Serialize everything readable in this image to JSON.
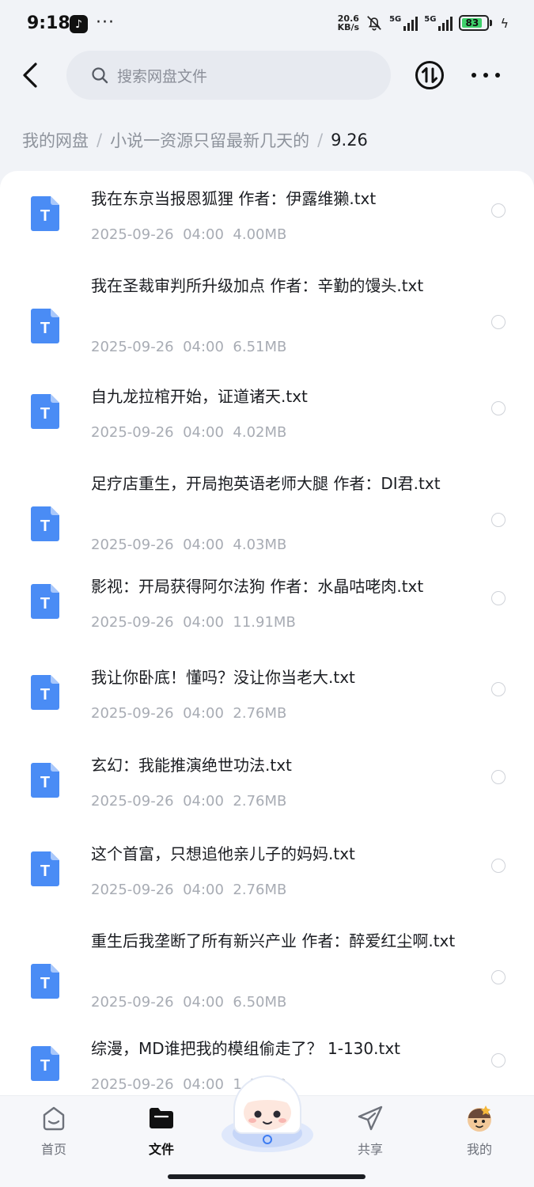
{
  "status_bar": {
    "time": "9:18",
    "more_dots": "···",
    "net_speed_value": "20.6",
    "net_speed_unit": "KB/s",
    "signal1_label": "5G",
    "signal2_label": "5G",
    "battery_level": "83"
  },
  "header": {
    "search_placeholder": "搜索网盘文件"
  },
  "breadcrumb": {
    "items": [
      "我的网盘",
      "小说一资源只留最新几天的",
      "9.26"
    ],
    "separator": "/"
  },
  "files": [
    {
      "name": "我在东京当报恩狐狸 作者：伊露维獭.txt",
      "date": "2025-09-26",
      "time": "04:00",
      "size": "4.00MB"
    },
    {
      "name": "我在圣裁审判所升级加点 作者：辛勤的馒头.txt",
      "date": "2025-09-26",
      "time": "04:00",
      "size": "6.51MB"
    },
    {
      "name": "自九龙拉棺开始，证道诸天.txt",
      "date": "2025-09-26",
      "time": "04:00",
      "size": "4.02MB"
    },
    {
      "name": "足疗店重生，开局抱英语老师大腿 作者：DI君.txt",
      "date": "2025-09-26",
      "time": "04:00",
      "size": "4.03MB"
    },
    {
      "name": "影视：开局获得阿尔法狗 作者：水晶咕咾肉.txt",
      "date": "2025-09-26",
      "time": "04:00",
      "size": "11.91MB"
    },
    {
      "name": "我让你卧底！懂吗？没让你当老大.txt",
      "date": "2025-09-26",
      "time": "04:00",
      "size": "2.76MB"
    },
    {
      "name": "玄幻：我能推演绝世功法.txt",
      "date": "2025-09-26",
      "time": "04:00",
      "size": "2.76MB"
    },
    {
      "name": "这个首富，只想追他亲儿子的妈妈.txt",
      "date": "2025-09-26",
      "time": "04:00",
      "size": "2.76MB"
    },
    {
      "name": "重生后我垄断了所有新兴产业 作者：醉爱红尘啊.txt",
      "date": "2025-09-26",
      "time": "04:00",
      "size": "6.50MB"
    },
    {
      "name": "综漫，MD谁把我的模组偷走了？ 1-130.txt",
      "date": "2025-09-26",
      "time": "04:00",
      "size": "1.48MB"
    }
  ],
  "file_icon_letter": "T",
  "bottom_nav": {
    "home": "首页",
    "files": "文件",
    "share": "共享",
    "mine": "我的"
  },
  "colors": {
    "accent": "#3d7cf2",
    "file_icon": "#4a8cf5"
  }
}
